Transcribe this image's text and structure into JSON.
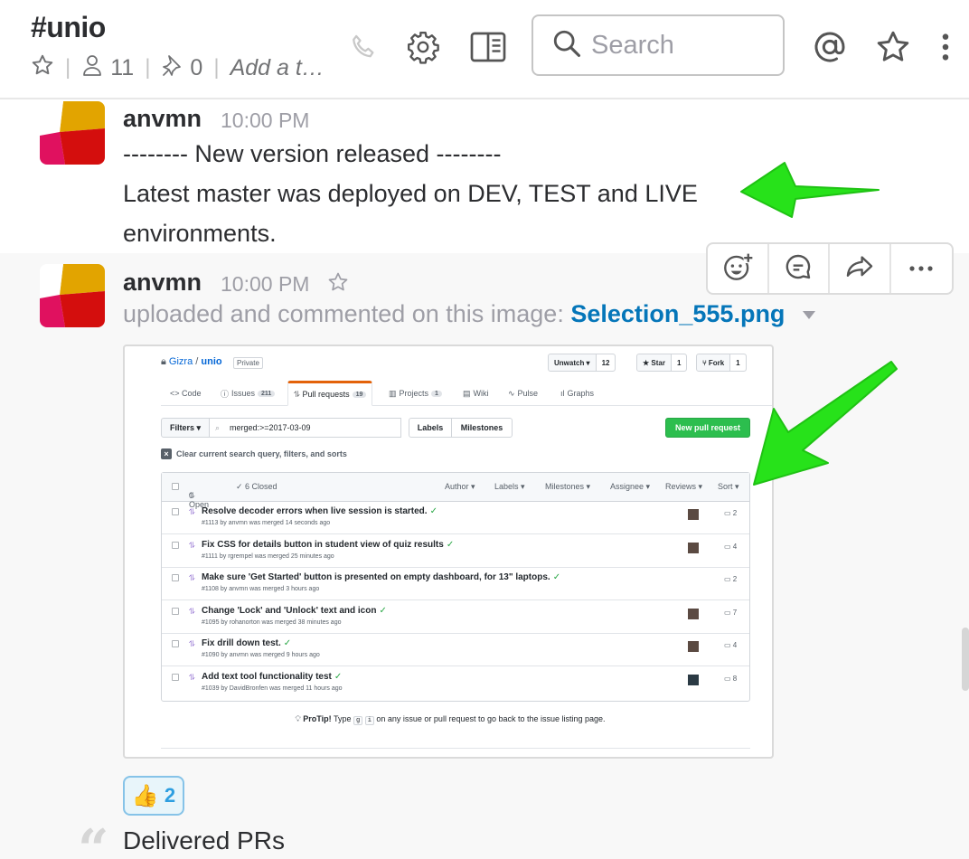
{
  "channel": {
    "name": "#unio",
    "member_count": "11",
    "pinned_count": "0",
    "topic_placeholder": "Add a t…"
  },
  "search": {
    "placeholder": "Search"
  },
  "messages": [
    {
      "user": "anvmn",
      "time": "10:00 PM",
      "lines": [
        "-------- New version released --------",
        "Latest master was deployed on DEV, TEST and LIVE",
        "environments."
      ]
    },
    {
      "user": "anvmn",
      "time": "10:00 PM",
      "upload_text": "uploaded and commented on this image:",
      "file_name": "Selection_555.png",
      "reaction": {
        "emoji": "👍",
        "count": "2"
      },
      "quote": "Delivered PRs"
    }
  ],
  "screenshot": {
    "owner": "Gizra",
    "repo": "unio",
    "private_label": "Private",
    "buttons": [
      {
        "label": "Unwatch ▾",
        "count": "12"
      },
      {
        "label": "★ Star",
        "count": "1"
      },
      {
        "label": "Fork",
        "count": "1"
      }
    ],
    "tabs": [
      {
        "label": "<> Code",
        "count": ""
      },
      {
        "label": "Issues",
        "count": "211"
      },
      {
        "label": "Pull requests",
        "count": "19"
      },
      {
        "label": "Projects",
        "count": "1"
      },
      {
        "label": "Wiki",
        "count": ""
      },
      {
        "label": "Pulse",
        "count": ""
      },
      {
        "label": "Graphs",
        "count": ""
      }
    ],
    "filters_label": "Filters ▾",
    "query": "merged:>=2017-03-09",
    "labels_btn": "Labels",
    "milestones_btn": "Milestones",
    "new_pr": "New pull request",
    "clear_text": "Clear current search query, filters, and sorts",
    "list_head": {
      "open": "0 Open",
      "closed": "✓ 6 Closed",
      "sorts": [
        "Author ▾",
        "Labels ▾",
        "Milestones ▾",
        "Assignee ▾",
        "Reviews ▾",
        "Sort ▾"
      ]
    },
    "prs": [
      {
        "title": "Resolve decoder errors when live session is started.",
        "sub": "#1113 by anvmn was merged 14 seconds ago",
        "comments": "2"
      },
      {
        "title": "Fix CSS for details button in student view of quiz results",
        "sub": "#1111 by rgrempel was merged 25 minutes ago",
        "comments": "4"
      },
      {
        "title": "Make sure 'Get Started' button is presented on empty dashboard, for 13\" laptops.",
        "sub": "#1108 by anvmn was merged 3 hours ago",
        "comments": "2"
      },
      {
        "title": "Change 'Lock' and 'Unlock' text and icon",
        "sub": "#1095 by rohanorton was merged 38 minutes ago",
        "comments": "7"
      },
      {
        "title": "Fix drill down test.",
        "sub": "#1090 by anvmn was merged 9 hours ago",
        "comments": "4"
      },
      {
        "title": "Add text tool functionality test",
        "sub": "#1039 by DavidBronfen was merged 11 hours ago",
        "comments": "8"
      }
    ],
    "protip": {
      "label": "ProTip!",
      "text1": " Type ",
      "key1": "g",
      "key2": "i",
      "text2": " on any issue or pull request to go back to the issue listing page."
    }
  },
  "colors": {
    "link": "#0576b9",
    "arrow": "#27e21a",
    "reaction_border": "#86c3e8",
    "new_pr_green": "#2cbe4e"
  }
}
